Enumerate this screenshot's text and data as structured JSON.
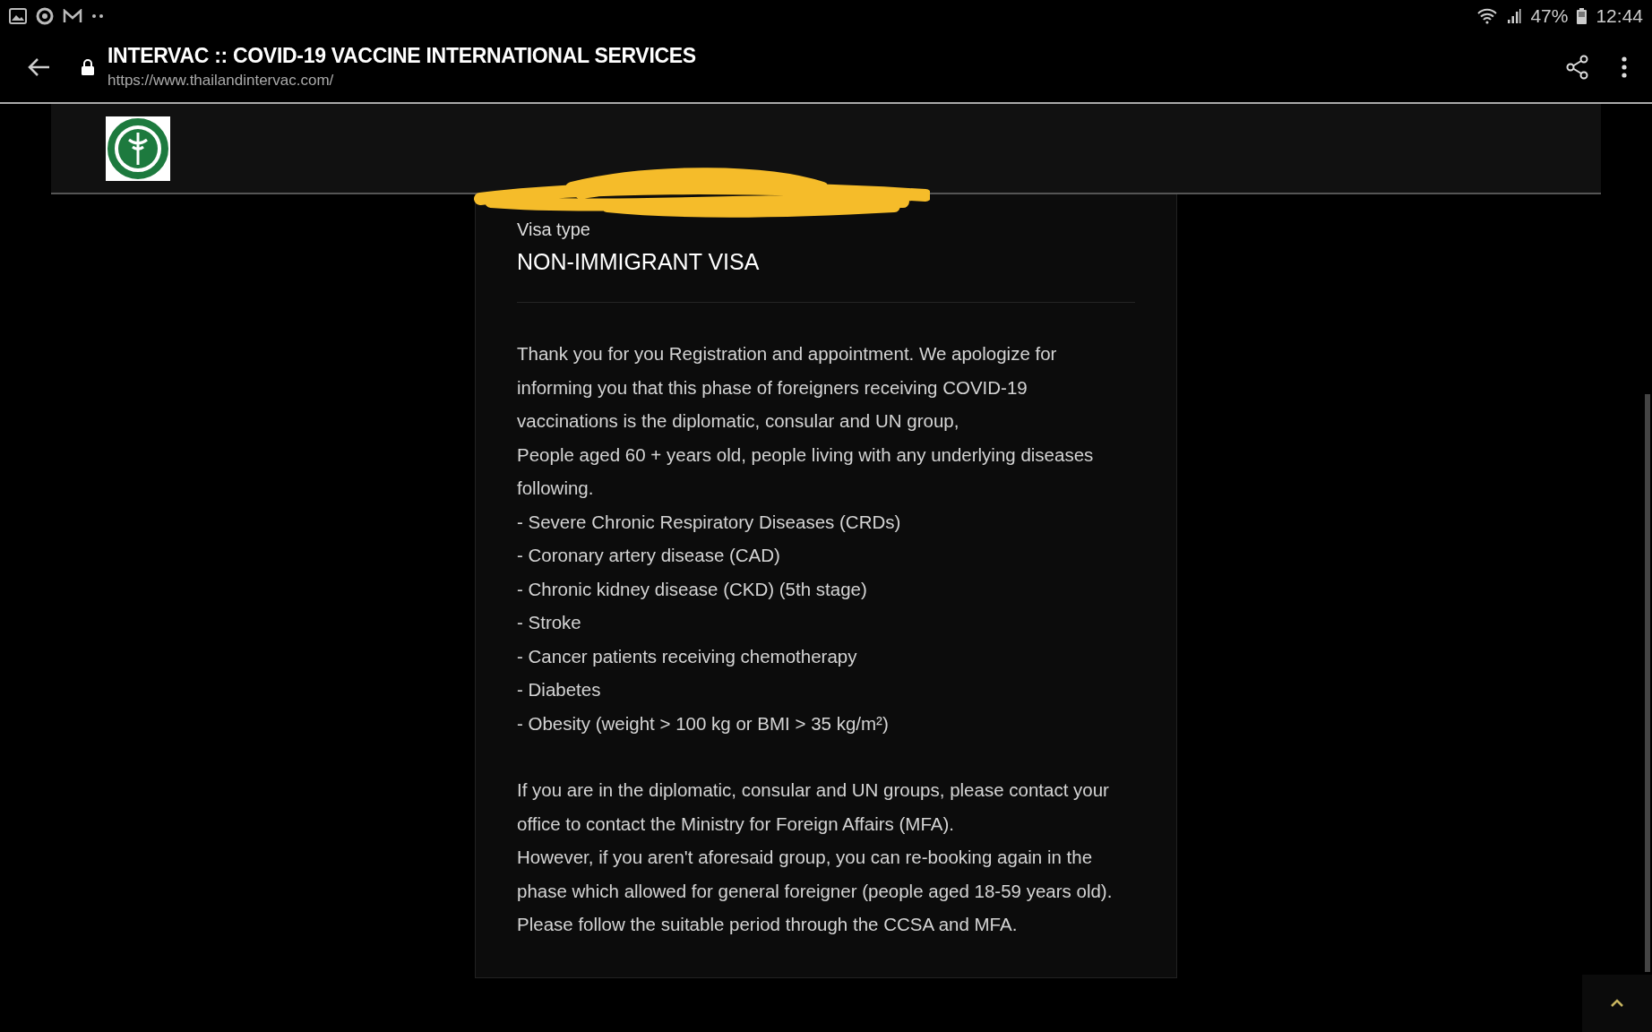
{
  "status_bar": {
    "battery": "47%",
    "time": "12:44"
  },
  "toolbar": {
    "title": "INTERVAC :: COVID-19 VACCINE INTERNATIONAL SERVICES",
    "url": "https://www.thailandintervac.com/"
  },
  "card": {
    "label": "Visa type",
    "value": "NON-IMMIGRANT VISA",
    "blocks": [
      [
        "Thank you for you Registration and appointment. We apologize for informing you that this phase of foreigners receiving COVID-19 vaccinations is the diplomatic, consular and UN group,",
        "People aged 60 + years old, people living with any underlying diseases following.",
        "- Severe Chronic Respiratory Diseases (CRDs)",
        "- Coronary artery disease (CAD)",
        "- Chronic kidney disease (CKD) (5th stage)",
        "- Stroke",
        "- Cancer patients receiving chemotherapy",
        "- Diabetes",
        "- Obesity (weight > 100 kg or BMI > 35 kg/m²)"
      ],
      [
        "If you are in the diplomatic, consular and UN groups, please contact your office to contact the Ministry for Foreign Affairs (MFA).",
        "However, if you aren't aforesaid group, you can re-booking again in the phase which allowed for general foreigner (people aged 18-59 years old).",
        "Please follow the suitable period through the CCSA and MFA."
      ]
    ]
  }
}
